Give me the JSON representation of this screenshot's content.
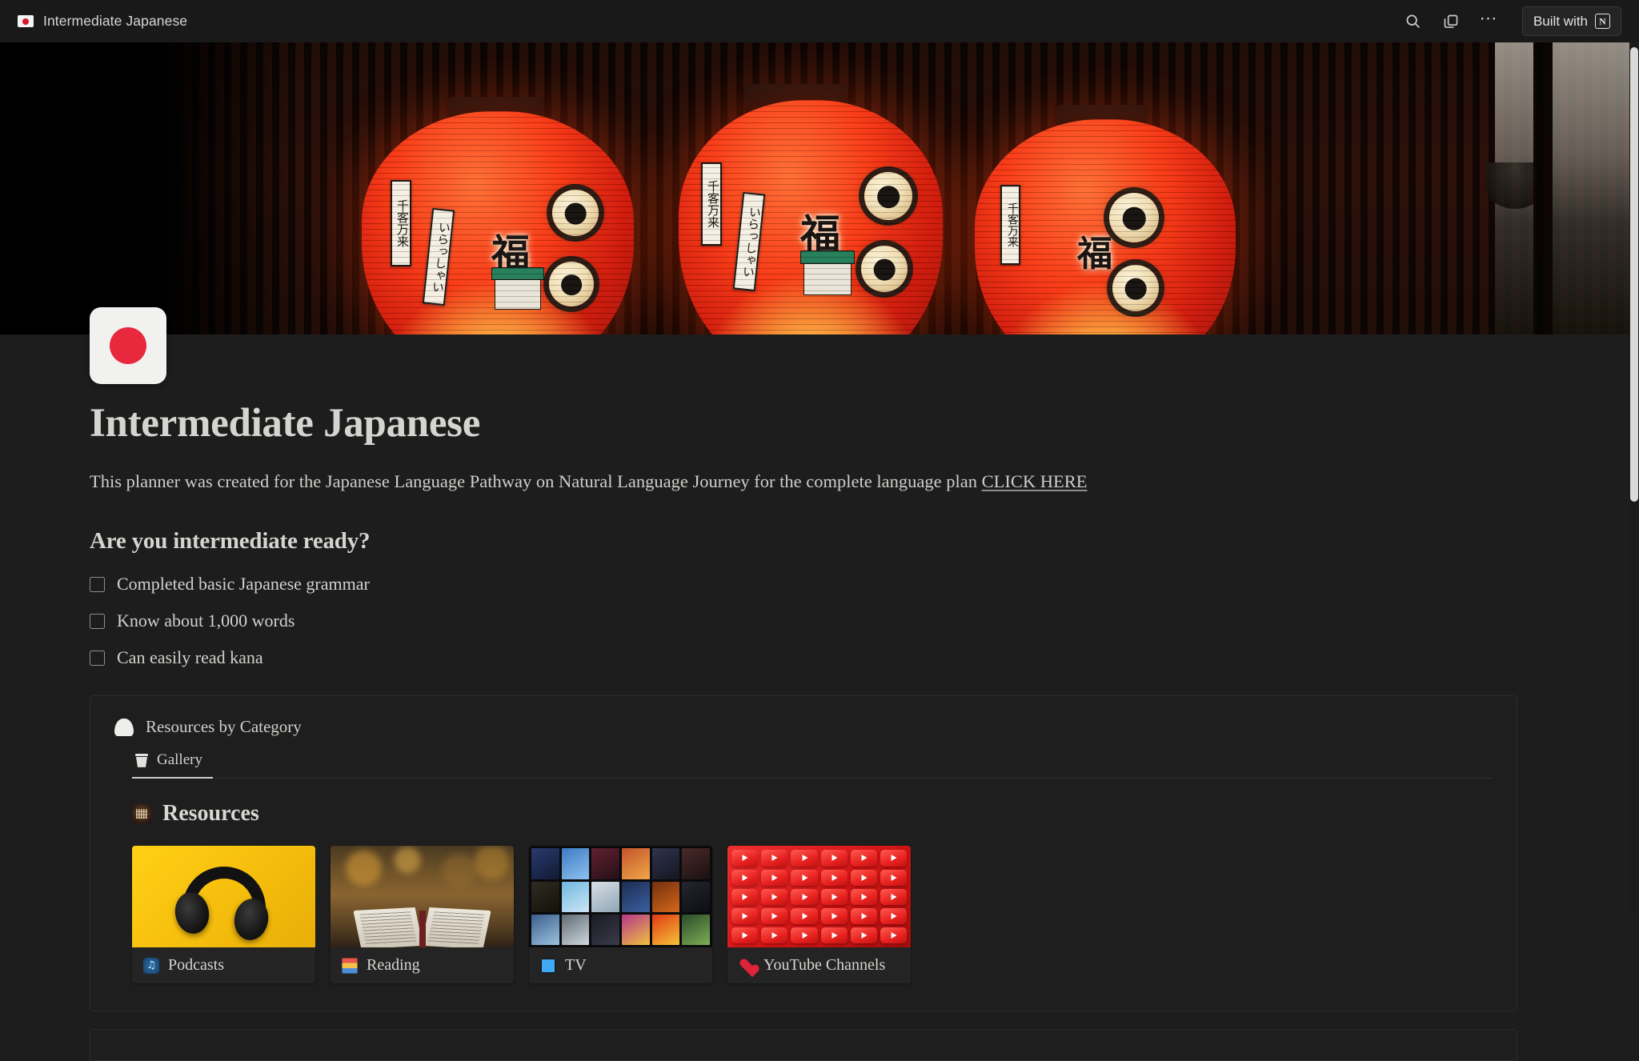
{
  "topbar": {
    "flag_icon": "japan-flag-icon",
    "title": "Intermediate Japanese",
    "search_icon": "search-icon",
    "duplicate_icon": "duplicate-icon",
    "more_icon": "more-options-icon",
    "built_with_label": "Built with",
    "built_with_brand": "N"
  },
  "cover": {
    "alt": "red japanese lanterns",
    "lantern_text_1": "千客万来",
    "lantern_text_2": "いらっしゃい",
    "lantern_text_3": "福"
  },
  "page": {
    "icon": "japan-flag-icon",
    "title": "Intermediate Japanese",
    "subtitle_text": "This planner was created for the Japanese Language Pathway on Natural Language Journey for the complete language plan ",
    "subtitle_link": "CLICK HERE"
  },
  "checklist": {
    "heading": "Are you intermediate ready?",
    "items": [
      {
        "label": "Completed basic Japanese grammar",
        "checked": false
      },
      {
        "label": "Know about 1,000 words",
        "checked": false
      },
      {
        "label": "Can easily read kana",
        "checked": false
      }
    ]
  },
  "database": {
    "icon": "onigiri-icon",
    "title": "Resources by Category",
    "tabs": [
      {
        "label": "Gallery",
        "icon": "gallery-view-icon",
        "active": true
      }
    ],
    "section_heading": "Resources",
    "section_emoji": "japanese-screen-emoji",
    "cards": [
      {
        "label": "Podcasts",
        "emoji": "musical-note-emoji",
        "image": "black-headphones-on-yellow"
      },
      {
        "label": "Reading",
        "emoji": "books-emoji",
        "image": "open-book-autumn"
      },
      {
        "label": "TV",
        "emoji": "television-emoji",
        "image": "anime-thumbnail-grid"
      },
      {
        "label": "YouTube Channels",
        "emoji": "red-heart-emoji",
        "image": "youtube-play-buttons"
      }
    ]
  },
  "colors": {
    "background": "#1d1d1d",
    "topbar": "#191919",
    "text": "#d5d4d0",
    "accent_red": "#e8283c",
    "card_bg": "#242424"
  }
}
